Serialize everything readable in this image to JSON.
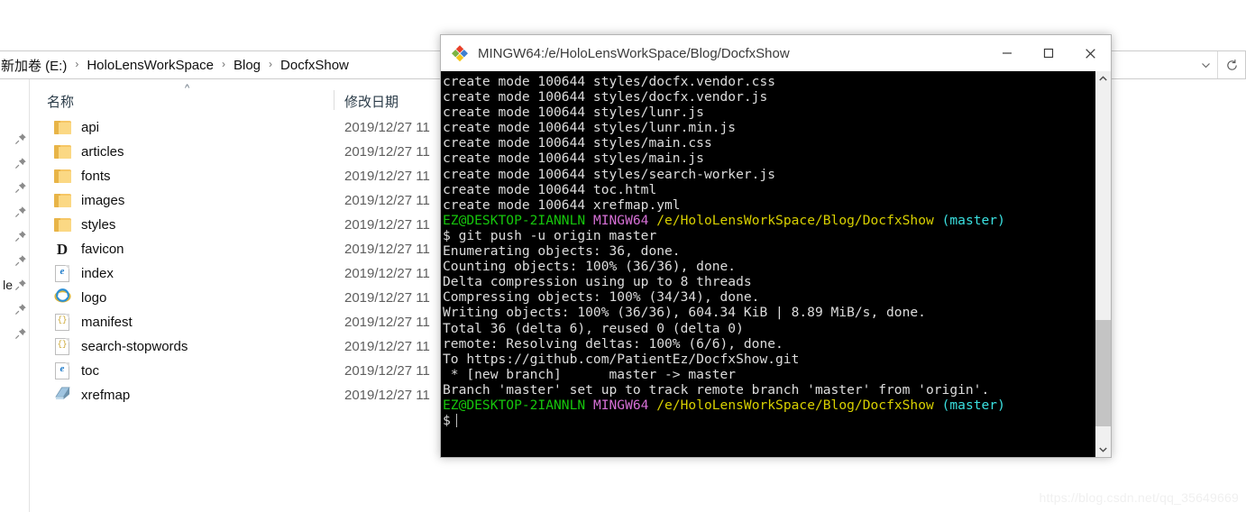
{
  "explorer": {
    "breadcrumb": {
      "items": [
        "新加卷 (E:)",
        "HoloLensWorkSpace",
        "Blog",
        "DocfxShow"
      ],
      "separator": "›"
    },
    "address_chevron_icon": "chevron-down-icon",
    "refresh_icon": "refresh-icon",
    "columns": {
      "name": "名称",
      "date_modified": "修改日期",
      "sort_arrow": "^"
    },
    "nav_pane": {
      "pin_icon": "pin-icon",
      "clipped_label": "le"
    },
    "files": [
      {
        "name": "api",
        "icon": "folder-icon",
        "date": "2019/12/27 11"
      },
      {
        "name": "articles",
        "icon": "folder-icon",
        "date": "2019/12/27 11"
      },
      {
        "name": "fonts",
        "icon": "folder-icon",
        "date": "2019/12/27 11"
      },
      {
        "name": "images",
        "icon": "folder-icon",
        "date": "2019/12/27 11"
      },
      {
        "name": "styles",
        "icon": "folder-icon",
        "date": "2019/12/27 11"
      },
      {
        "name": "favicon",
        "icon": "d-font-icon",
        "date": "2019/12/27 11"
      },
      {
        "name": "index",
        "icon": "html-file-icon",
        "date": "2019/12/27 11"
      },
      {
        "name": "logo",
        "icon": "ie-logo-icon",
        "date": "2019/12/27 11"
      },
      {
        "name": "manifest",
        "icon": "json-file-icon",
        "date": "2019/12/27 11"
      },
      {
        "name": "search-stopwords",
        "icon": "json-file-icon",
        "date": "2019/12/27 11"
      },
      {
        "name": "toc",
        "icon": "html-file-icon",
        "date": "2019/12/27 11"
      },
      {
        "name": "xrefmap",
        "icon": "yml-file-icon",
        "date": "2019/12/27 11"
      }
    ]
  },
  "terminal": {
    "app_icon": "git-bash-icon",
    "title": "MINGW64:/e/HoloLensWorkSpace/Blog/DocfxShow",
    "window_buttons": {
      "minimize": "minimize-icon",
      "maximize": "maximize-icon",
      "close": "close-icon"
    },
    "colors": {
      "background": "#000000",
      "text": "#d8d8d8",
      "user_host": "#16c60c",
      "shell_name": "#d670d6",
      "path": "#d8d000",
      "branch": "#3ae0e0"
    },
    "prompt": {
      "user_host": "EZ@DESKTOP-2IANNLN",
      "shell": "MINGW64",
      "path": "/e/HoloLensWorkSpace/Blog/DocfxShow",
      "branch": "(master)",
      "symbol": "$"
    },
    "lines_top": [
      "create mode 100644 styles/docfx.vendor.css",
      "create mode 100644 styles/docfx.vendor.js",
      "create mode 100644 styles/lunr.js",
      "create mode 100644 styles/lunr.min.js",
      "create mode 100644 styles/main.css",
      "create mode 100644 styles/main.js",
      "create mode 100644 styles/search-worker.js",
      "create mode 100644 toc.html",
      "create mode 100644 xrefmap.yml"
    ],
    "command": "$ git push -u origin master",
    "lines_output": [
      "Enumerating objects: 36, done.",
      "Counting objects: 100% (36/36), done.",
      "Delta compression using up to 8 threads",
      "Compressing objects: 100% (34/34), done.",
      "Writing objects: 100% (36/36), 604.34 KiB | 8.89 MiB/s, done.",
      "Total 36 (delta 6), reused 0 (delta 0)",
      "remote: Resolving deltas: 100% (6/6), done.",
      "To https://github.com/PatientEz/DocfxShow.git",
      " * [new branch]      master -> master",
      "Branch 'master' set up to track remote branch 'master' from 'origin'."
    ],
    "scrollbar": {
      "up_icon": "chevron-up-icon",
      "down_icon": "chevron-down-icon"
    }
  },
  "watermark": "https://blog.csdn.net/qq_35649669"
}
